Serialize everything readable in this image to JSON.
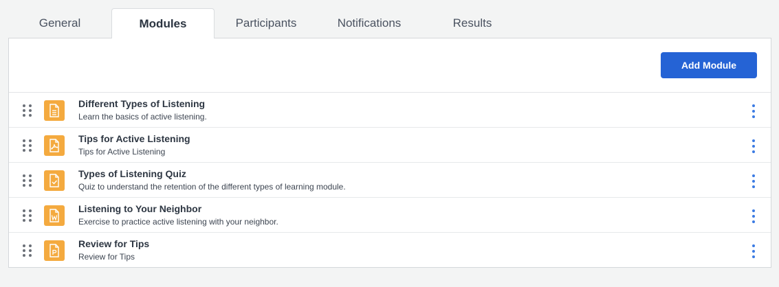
{
  "tabs": [
    {
      "label": "General"
    },
    {
      "label": "Modules",
      "active": true
    },
    {
      "label": "Participants"
    },
    {
      "label": "Notifications"
    },
    {
      "label": "Results"
    }
  ],
  "toolbar": {
    "add_module_label": "Add Module"
  },
  "modules": [
    {
      "title": "Different Types of Listening",
      "description": "Learn the basics of active listening.",
      "icon": "document-icon"
    },
    {
      "title": "Tips for Active Listening",
      "description": "Tips for Active Listening",
      "icon": "pdf-icon"
    },
    {
      "title": "Types of Listening Quiz",
      "description": "Quiz to understand the retention of the different types of learning module.",
      "icon": "quiz-icon"
    },
    {
      "title": "Listening to Your Neighbor",
      "description": "Exercise to practice active listening with your neighbor.",
      "icon": "word-doc-icon"
    },
    {
      "title": "Review for Tips",
      "description": "Review for Tips",
      "icon": "powerpoint-icon"
    }
  ],
  "colors": {
    "accent": "#2563d5",
    "icon_bg": "#f4aa3f",
    "kebab": "#3b7be3",
    "background": "#f3f4f4"
  }
}
